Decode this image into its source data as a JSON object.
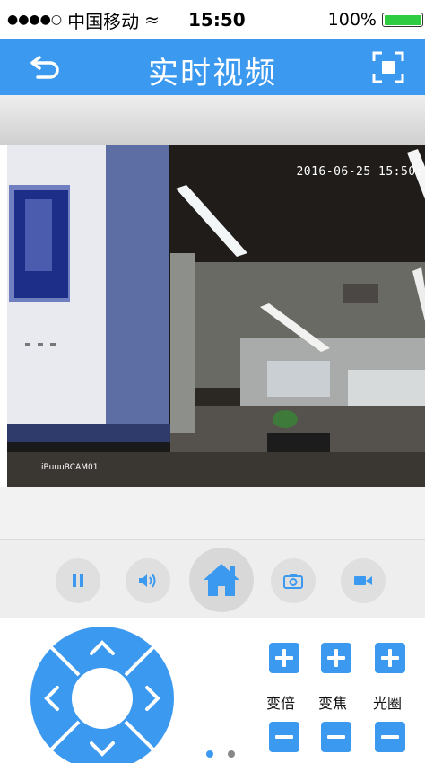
{
  "status_bar": {
    "signal_dots": "●●●●○",
    "carrier": "中国移动",
    "wifi_glyph": "≈",
    "time": "15:50",
    "battery_text": "100%",
    "battery_level": 1.0
  },
  "nav": {
    "title": "实时视频",
    "back_icon": "back-arrow-icon",
    "fullscreen_icon": "fullscreen-icon"
  },
  "video": {
    "timestamp": "2016-06-25 15:50:",
    "camera_name": "iBuuuBCAM01"
  },
  "toolbar": {
    "buttons": [
      "pause-icon",
      "volume-icon",
      "home-icon",
      "camera-icon",
      "record-icon"
    ]
  },
  "ptz": {
    "labels": [
      "变倍",
      "变焦",
      "光圈"
    ]
  },
  "pager": {
    "pages": 2,
    "active_page": 1
  },
  "colors": {
    "accent": "#3c99f0",
    "button_gray": "#dfdfdf",
    "toolbar_bg": "#eeeeee"
  }
}
